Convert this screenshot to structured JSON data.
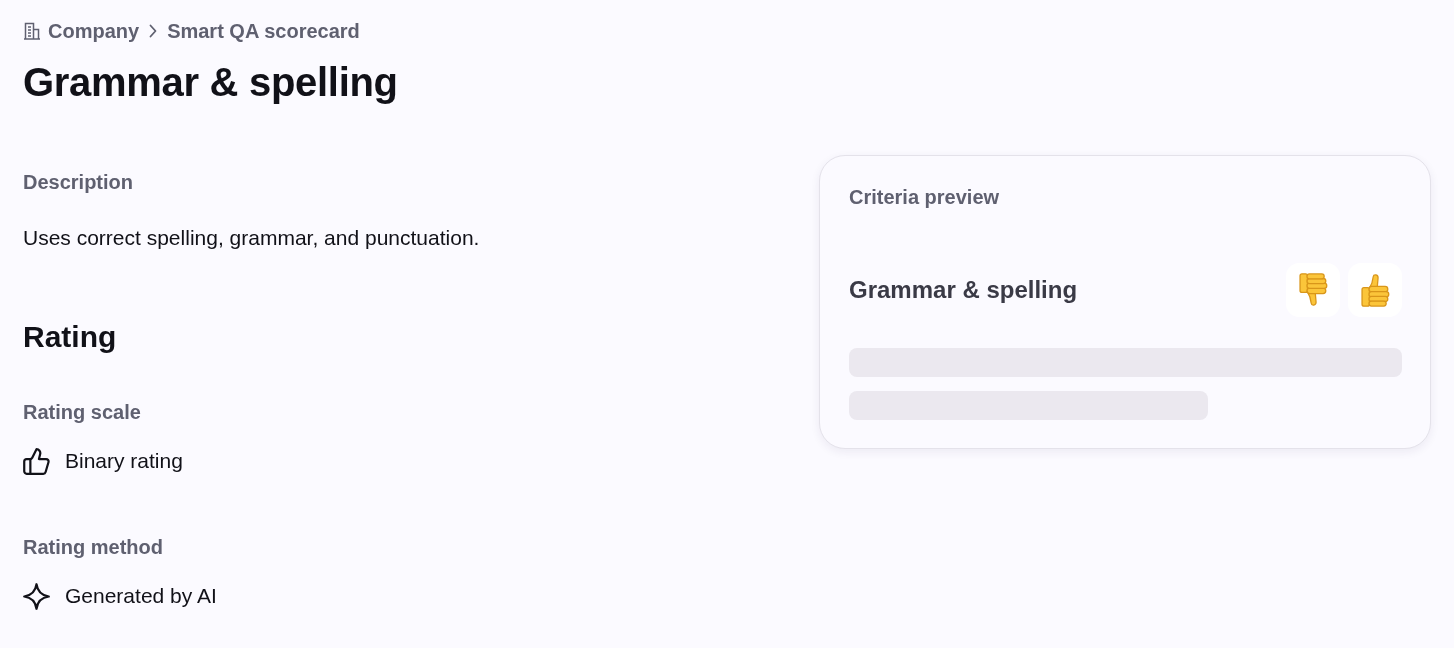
{
  "breadcrumb": [
    {
      "label": "Company"
    },
    {
      "label": "Smart QA scorecard"
    }
  ],
  "title": "Grammar & spelling",
  "description": {
    "label": "Description",
    "text": "Uses correct spelling, grammar, and punctuation."
  },
  "rating": {
    "heading": "Rating",
    "fields": [
      {
        "label": "Rating scale",
        "value": "Binary rating",
        "kind": "scale"
      },
      {
        "label": "Rating method",
        "value": "Generated by AI",
        "kind": "method"
      }
    ]
  },
  "preview": {
    "title": "Criteria preview",
    "criterion": "Grammar & spelling",
    "buttons": [
      {
        "kind": "thumbs_down"
      },
      {
        "kind": "thumbs_up"
      }
    ]
  }
}
